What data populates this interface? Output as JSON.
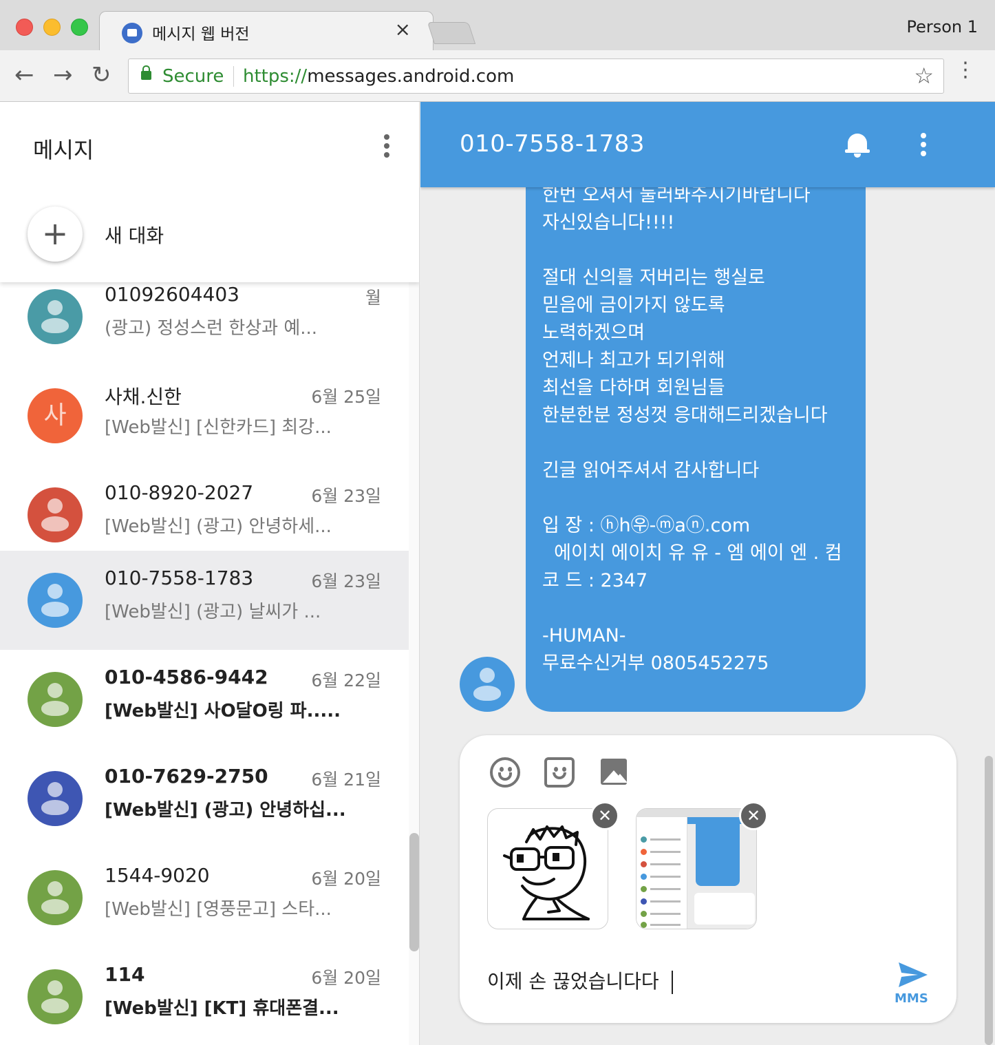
{
  "browser": {
    "tab_title": "메시지 웹 버전",
    "tab_close": "×",
    "profile": "Person 1",
    "back": "←",
    "forward": "→",
    "reload": "↻",
    "secure_label": "Secure",
    "url_scheme": "https://",
    "url_host": "messages.android.com",
    "bookmark_star": "☆",
    "menu": "⋮"
  },
  "sidebar": {
    "title": "메시지",
    "new_conversation_icon": "+",
    "new_conversation_label": "새 대화",
    "conversations": [
      {
        "name": "01092604403",
        "date": "월",
        "snippet": "(광고) 정성스런 한상과 예...",
        "avatar_color": "#4a9ba6",
        "letter": "",
        "unread": false,
        "selected": false
      },
      {
        "name": "사채.신한",
        "date": "6월 25일",
        "snippet": "[Web발신] [신한카드] 최강...",
        "avatar_color": "#f0643a",
        "letter": "사",
        "unread": false,
        "selected": false
      },
      {
        "name": "010-8920-2027",
        "date": "6월 23일",
        "snippet": "[Web발신] (광고) 안녕하세...",
        "avatar_color": "#d4513e",
        "letter": "",
        "unread": false,
        "selected": false
      },
      {
        "name": "010-7558-1783",
        "date": "6월 23일",
        "snippet": "[Web발신] (광고) 날씨가 ...",
        "avatar_color": "#4799de",
        "letter": "",
        "unread": false,
        "selected": true
      },
      {
        "name": "010-4586-9442",
        "date": "6월 22일",
        "snippet": "[Web발신] 사O달O링 파.....",
        "avatar_color": "#73a246",
        "letter": "",
        "unread": true,
        "selected": false
      },
      {
        "name": "010-7629-2750",
        "date": "6월 21일",
        "snippet": "[Web발신] (광고) 안녕하십...",
        "avatar_color": "#3e56b3",
        "letter": "",
        "unread": true,
        "selected": false
      },
      {
        "name": "1544-9020",
        "date": "6월 20일",
        "snippet": "[Web발신] [영풍문고] 스타...",
        "avatar_color": "#73a246",
        "letter": "",
        "unread": false,
        "selected": false
      },
      {
        "name": "114",
        "date": "6월 20일",
        "snippet": "[Web발신] [KT] 휴대폰결...",
        "avatar_color": "#73a246",
        "letter": "",
        "unread": true,
        "selected": false
      }
    ]
  },
  "conversation": {
    "title": "010-7558-1783",
    "accent_color": "#4799de",
    "message_text": "회원님들을 만족시키지 않겠습니다\n한번 오셔서 둘러봐주시기바랍니다\n자신있습니다!!!!\n\n절대 신의를 저버리는 행실로\n믿음에 금이가지 않도록\n노력하겠으며\n언제나 최고가 되기위해\n최선을 다하며 회원님들\n한분한분 정성껏 응대해드리겠습니다\n\n긴글 읽어주셔서 감사합니다\n\n입 장 : ⓗh㉾-ⓜaⓝ.com\n  에이치 에이치 유 유 - 엠 에이 엔 . 컴\n코 드 : 2347\n\n-HUMAN-\n무료수신거부 0805452275",
    "compose": {
      "draft_text": "이제 손 끊었습니다다",
      "send_label": "MMS",
      "remove_icon": "✕"
    }
  }
}
